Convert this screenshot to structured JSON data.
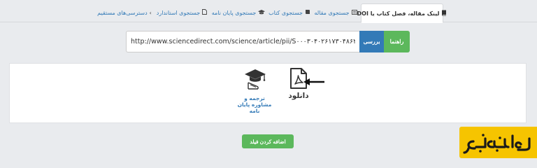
{
  "tabs": [
    {
      "label": "لینک مقاله، فصل کتاب یا DOI",
      "icon": "book-icon",
      "active": true
    },
    {
      "label": "جستجوی مقاله",
      "icon": "newspaper-icon",
      "active": false
    },
    {
      "label": "جستجوی کتاب",
      "icon": "book-open-icon",
      "active": false
    },
    {
      "label": "جستجوی پایان نامه",
      "icon": "graduation-cap-icon",
      "active": false
    },
    {
      "label": "جستجوی استاندارد",
      "icon": "file-icon",
      "active": false
    },
    {
      "label": "دسترسی‌های مستقیم",
      "icon": "chevron-right-icon",
      "active": false
    }
  ],
  "search": {
    "value": "http://www.sciencedirect.com/science/article/pii/S۰۰۰۳۰۴۰۲۶۱۷۳۰۴۸۶۲",
    "check_label": "بررسی",
    "guide_label": "راهنما"
  },
  "result": {
    "download_label": "دانلود",
    "thesis_label": "ترجمه و مشاوره پایان نامه"
  },
  "add_field_label": "اضافه کردن فیلد",
  "logo": {
    "text": "ساعدنیوز"
  },
  "colors": {
    "primary": "#337ab7",
    "success": "#5cb85c",
    "logo_bg": "#f6c400"
  }
}
